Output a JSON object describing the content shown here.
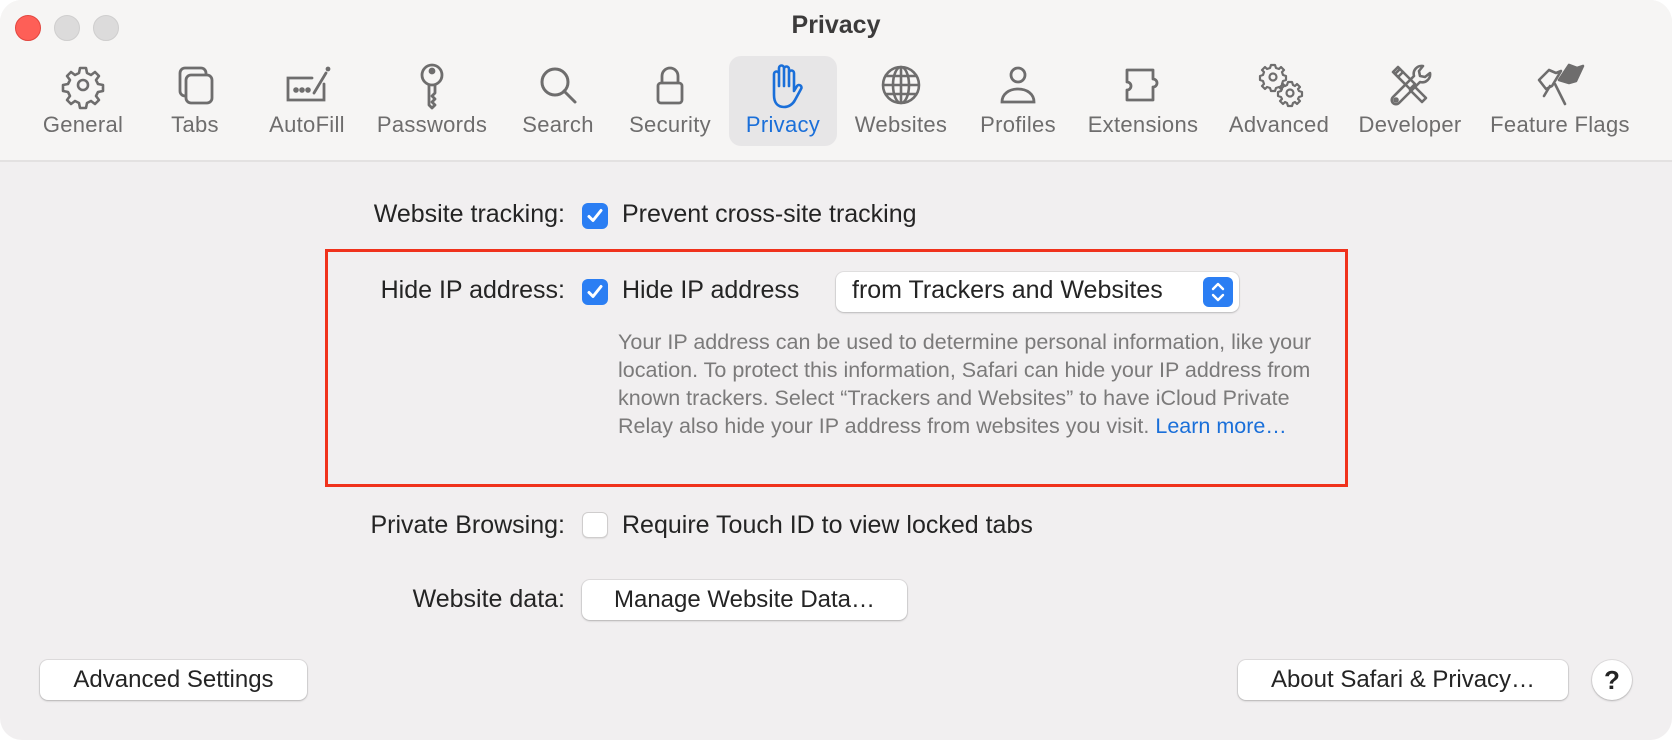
{
  "window": {
    "title": "Privacy",
    "traffic_lights": [
      "close",
      "minimize",
      "zoom"
    ]
  },
  "toolbar": {
    "items": [
      {
        "label": "General",
        "icon": "gear-icon",
        "active": false
      },
      {
        "label": "Tabs",
        "icon": "tabs-icon",
        "active": false
      },
      {
        "label": "AutoFill",
        "icon": "autofill-icon",
        "active": false
      },
      {
        "label": "Passwords",
        "icon": "key-icon",
        "active": false
      },
      {
        "label": "Search",
        "icon": "search-icon",
        "active": false
      },
      {
        "label": "Security",
        "icon": "lock-icon",
        "active": false
      },
      {
        "label": "Privacy",
        "icon": "hand-icon",
        "active": true
      },
      {
        "label": "Websites",
        "icon": "globe-icon",
        "active": false
      },
      {
        "label": "Profiles",
        "icon": "person-icon",
        "active": false
      },
      {
        "label": "Extensions",
        "icon": "puzzle-icon",
        "active": false
      },
      {
        "label": "Advanced",
        "icon": "gears-icon",
        "active": false
      },
      {
        "label": "Developer",
        "icon": "tools-icon",
        "active": false
      },
      {
        "label": "Feature Flags",
        "icon": "flags-icon",
        "active": false
      }
    ],
    "active_color": "#1a6fd9"
  },
  "settings": {
    "website_tracking": {
      "label": "Website tracking:",
      "option": "Prevent cross-site tracking",
      "checked": true
    },
    "hide_ip": {
      "label": "Hide IP address:",
      "option": "Hide IP address",
      "checked": true,
      "popup_value": "from Trackers and Websites",
      "description": "Your IP address can be used to determine personal information, like your location. To protect this information, Safari can hide your IP address from known trackers. Select “Trackers and Websites” to have iCloud Private Relay also hide your IP address from websites you visit.",
      "learn_more": "Learn more…"
    },
    "private_browsing": {
      "label": "Private Browsing:",
      "option": "Require Touch ID to view locked tabs",
      "checked": false
    },
    "website_data": {
      "label": "Website data:",
      "button": "Manage Website Data…"
    }
  },
  "footer": {
    "advanced_settings": "Advanced Settings",
    "about": "About Safari & Privacy…",
    "help": "?"
  },
  "colors": {
    "accent": "#2b7ef3",
    "highlight_border": "#f0321c",
    "close": "#fe5f57"
  }
}
